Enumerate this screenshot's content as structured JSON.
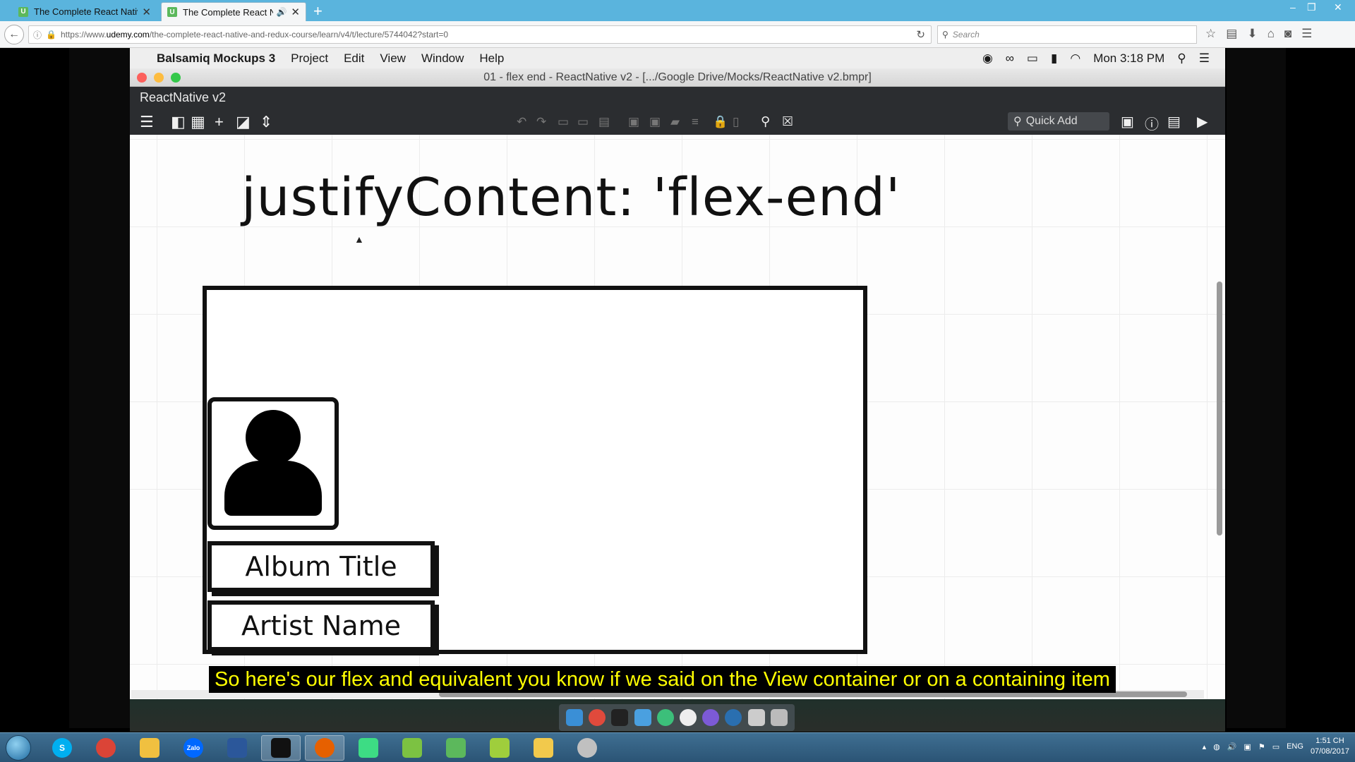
{
  "browser": {
    "tabs": [
      {
        "title": "The Complete React Native",
        "favicon": "U"
      },
      {
        "title": "The Complete React Nat",
        "favicon": "U"
      }
    ],
    "url_prefix": "https://www.",
    "url_host": "udemy.com",
    "url_path": "/the-complete-react-native-and-redux-course/learn/v4/t/lecture/5744042?start=0",
    "search_placeholder": "Search"
  },
  "mac": {
    "app_name": "Balsamiq Mockups 3",
    "menus": [
      "Project",
      "Edit",
      "View",
      "Window",
      "Help"
    ],
    "clock": "Mon 3:18 PM"
  },
  "balsamiq": {
    "window_title": "01 - flex end - ReactNative v2 - [.../Google Drive/Mocks/ReactNative v2.bmpr]",
    "project_name": "ReactNative v2",
    "quick_add": "Quick Add",
    "heading": "justifyContent: 'flex-end'",
    "album_title": "Album Title",
    "artist_name": "Artist Name"
  },
  "caption": "So here's our flex and equivalent you know if we said on the View container or on a containing item",
  "taskbar": {
    "apps": [
      "start",
      "skype",
      "chrome",
      "files",
      "zalo",
      "word",
      "terminal",
      "firefox",
      "android-studio",
      "notes",
      "home",
      "sheets",
      "explorer",
      "paint"
    ],
    "lang": "ENG",
    "time": "1:51 CH",
    "date": "07/08/2017"
  }
}
